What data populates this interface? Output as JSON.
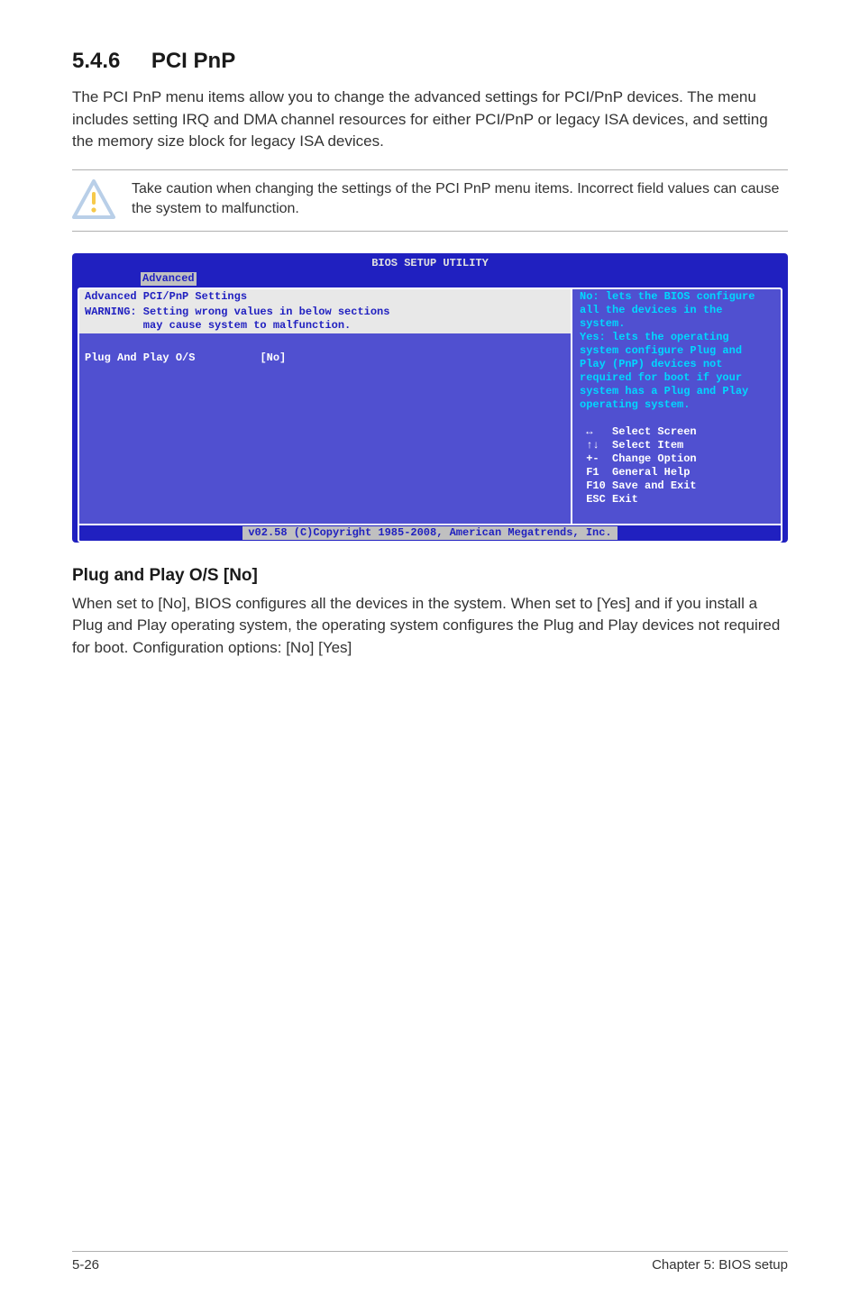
{
  "section": {
    "number": "5.4.6",
    "title": "PCI PnP",
    "intro": "The PCI PnP menu items allow you to change the advanced settings for PCI/PnP devices. The menu includes setting IRQ and DMA channel resources for either PCI/PnP or legacy ISA devices, and setting the memory size block for legacy ISA devices."
  },
  "caution": {
    "text": "Take caution when changing the settings of the PCI PnP menu items. Incorrect field values can cause the system to malfunction."
  },
  "bios": {
    "title": "BIOS SETUP UTILITY",
    "active_tab": "Advanced",
    "left": {
      "heading": "Advanced PCI/PnP Settings",
      "warning_line1": "WARNING: Setting wrong values in below sections",
      "warning_line2": "         may cause system to malfunction.",
      "row_label": "Plug And Play O/S",
      "row_value": "[No]"
    },
    "help_text": "No: lets the BIOS configure all the devices in the system.\nYes: lets the operating system configure Plug and Play (PnP) devices not required for boot if your system has a Plug and Play operating system.",
    "keys": [
      {
        "icon": "↔",
        "label": "Select Screen"
      },
      {
        "icon": "↑↓",
        "label": "Select Item"
      },
      {
        "icon": "+-",
        "label": "Change Option"
      },
      {
        "icon": "F1",
        "label": "General Help"
      },
      {
        "icon": "F10",
        "label": "Save and Exit"
      },
      {
        "icon": "ESC",
        "label": "Exit"
      }
    ],
    "footer": "v02.58 (C)Copyright 1985-2008, American Megatrends, Inc."
  },
  "subsection": {
    "header": "Plug and Play O/S [No]",
    "body": "When set to [No], BIOS configures all the devices in the system. When set to [Yes] and if you install a Plug and Play operating system, the operating system configures the Plug and Play devices not required for boot. Configuration options: [No] [Yes]"
  },
  "footer": {
    "left": "5-26",
    "right": "Chapter 5: BIOS setup"
  }
}
